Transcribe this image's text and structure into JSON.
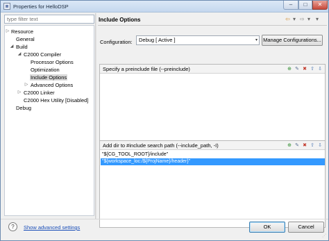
{
  "window": {
    "title": "Properties for HelloDSP",
    "min_symbol": "–",
    "max_symbol": "□",
    "close_symbol": "✕"
  },
  "filter": {
    "placeholder": "type filter text"
  },
  "tree": {
    "items": [
      {
        "label": "Resource",
        "arrow": "▷"
      },
      {
        "label": "General",
        "arrow": ""
      },
      {
        "label": "Build",
        "arrow": "◢"
      },
      {
        "label": "C2000 Compiler",
        "arrow": "◢"
      },
      {
        "label": "Processor Options",
        "arrow": ""
      },
      {
        "label": "Optimization",
        "arrow": ""
      },
      {
        "label": "Include Options",
        "arrow": "",
        "selected": true
      },
      {
        "label": "Advanced Options",
        "arrow": "▷"
      },
      {
        "label": "C2000 Linker",
        "arrow": "▷"
      },
      {
        "label": "C2000 Hex Utility  [Disabled]",
        "arrow": ""
      },
      {
        "label": "Debug",
        "arrow": ""
      }
    ]
  },
  "page": {
    "title": "Include Options",
    "nav_back": "⇦",
    "nav_back_dd": "▾",
    "nav_fwd": "⇨",
    "nav_fwd_dd": "▾",
    "nav_menu": "▾"
  },
  "configuration": {
    "label": "Configuration:",
    "value": "Debug  [ Active ]",
    "dropdown_symbol": "▾",
    "manage_label": "Manage Configurations..."
  },
  "groups": {
    "preinclude": {
      "title": "Specify a preinclude file (--preinclude)",
      "rows": []
    },
    "include_path": {
      "title": "Add dir to #include search path (--include_path, -I)",
      "rows": [
        {
          "text": "\"${CG_TOOL_ROOT}/include\"",
          "selected": false
        },
        {
          "text": "\"${workspace_loc:/${ProjName}/header}\"",
          "selected": true
        }
      ]
    },
    "icons": {
      "add": "⊕",
      "edit": "✎",
      "delete": "✖",
      "up": "⇧",
      "down": "⇩"
    }
  },
  "footer": {
    "help_symbol": "?",
    "show_advanced": "Show advanced settings",
    "ok": "OK",
    "cancel": "Cancel",
    "grip": "⋰"
  }
}
